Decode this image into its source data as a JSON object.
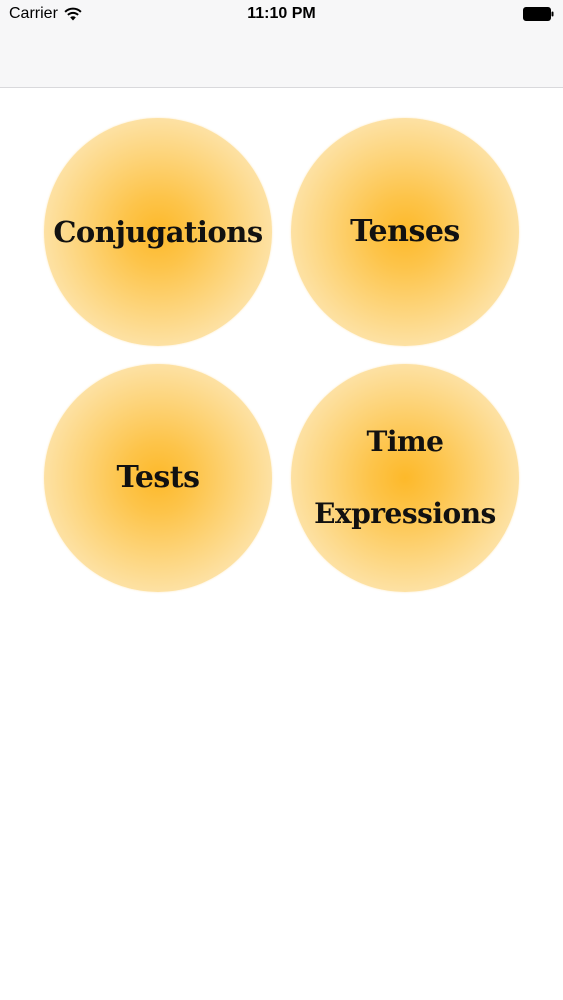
{
  "status_bar": {
    "carrier": "Carrier",
    "time": "11:10 PM",
    "wifi_icon": "wifi-icon",
    "battery_icon": "battery-icon"
  },
  "menu": {
    "items": [
      {
        "label": "Conjugations"
      },
      {
        "label": "Tenses"
      },
      {
        "label": "Tests"
      },
      {
        "label": "Time\nExpressions"
      }
    ]
  },
  "colors": {
    "bubble_center": "#fdb92a",
    "bubble_edge": "#fff0d0",
    "nav_background": "#f7f7f8"
  }
}
